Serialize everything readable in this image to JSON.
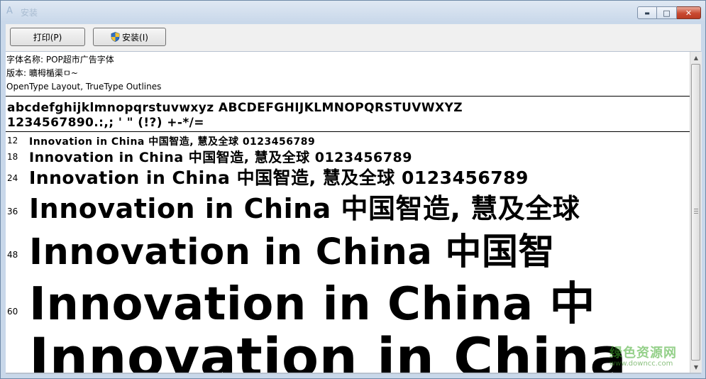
{
  "window": {
    "title": "安装",
    "minimize_glyph": "▬",
    "maximize_glyph": "□",
    "close_glyph": "✕"
  },
  "toolbar": {
    "print_label": "打印(P)",
    "install_label": "安装(I)"
  },
  "font_info": {
    "name_line": "字体名称: POP超市广告字体",
    "version_line": "版本: 曠栂楯渠ㅁ~",
    "type_line": "OpenType Layout, TrueType Outlines"
  },
  "charset": {
    "line1": "abcdefghijklmnopqrstuvwxyz ABCDEFGHIJKLMNOPQRSTUVWXYZ",
    "line2": "1234567890.:,; ' \" (!?) +-*/="
  },
  "samples": [
    {
      "size": "12",
      "text": "Innovation in China 中国智造, 慧及全球 0123456789"
    },
    {
      "size": "18",
      "text": "Innovation in China 中国智造, 慧及全球 0123456789"
    },
    {
      "size": "24",
      "text": "Innovation in China 中国智造, 慧及全球 0123456789"
    },
    {
      "size": "36",
      "text": "Innovation in China 中国智造, 慧及全球"
    },
    {
      "size": "48",
      "text": "Innovation in China 中国智"
    },
    {
      "size": "60",
      "text": "Innovation in China 中"
    },
    {
      "size": "",
      "text": "Innovation in China"
    }
  ],
  "watermark": {
    "main": "绿色资源网",
    "sub": "www.downcc.com"
  },
  "colors": {
    "frame": "#c9d8ea",
    "close_button": "#c94a31",
    "watermark": "#3caa28"
  }
}
